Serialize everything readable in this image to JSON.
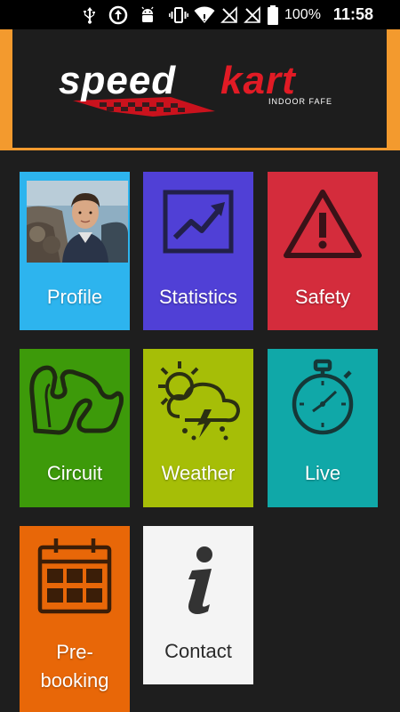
{
  "status_bar": {
    "battery_percent": "100%",
    "time": "11:58",
    "icons": [
      "usb-icon",
      "sync-icon",
      "android-icon",
      "vibrate-icon",
      "wifi-icon",
      "no-sim-icon",
      "no-sim-icon",
      "battery-icon"
    ]
  },
  "header": {
    "logo_text": "speedkart",
    "logo_subtext": "INDOOR FAFE",
    "accent_color": "#f39a2e"
  },
  "tiles": [
    {
      "label": "Profile",
      "color": "#2db4ee",
      "icon": "profile-photo"
    },
    {
      "label": "Statistics",
      "color": "#5040d6",
      "icon": "chart-icon"
    },
    {
      "label": "Safety",
      "color": "#d42c3c",
      "icon": "warning-icon"
    },
    {
      "label": "Circuit",
      "color": "#3d9a0a",
      "icon": "track-icon"
    },
    {
      "label": "Weather",
      "color": "#a6be07",
      "icon": "weather-icon"
    },
    {
      "label": "Live",
      "color": "#10a8a8",
      "icon": "stopwatch-icon"
    },
    {
      "label": "Pre-booking",
      "label_lines": [
        "Pre-",
        "booking"
      ],
      "color": "#e86708",
      "icon": "calendar-icon"
    },
    {
      "label": "Contact",
      "color": "#f4f4f4",
      "icon": "info-icon"
    }
  ]
}
